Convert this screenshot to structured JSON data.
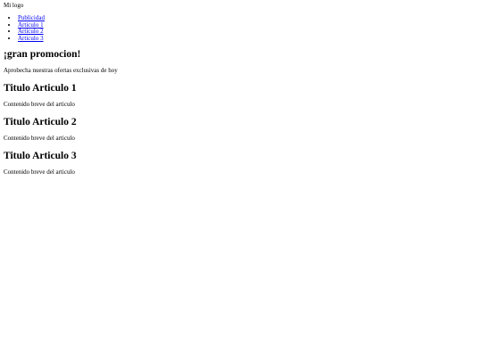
{
  "header": {
    "logo_text": "Mi logo"
  },
  "nav": {
    "items": [
      {
        "label": "Publicidad"
      },
      {
        "label": "Articulo 1"
      },
      {
        "label": "Articulo 2"
      },
      {
        "label": "Articulo 3"
      }
    ]
  },
  "promo": {
    "title": "¡gran promocion!",
    "text": "Aprobecha nuestras ofertas exclusivas de hoy"
  },
  "articles": [
    {
      "title": "Titulo Articulo 1",
      "summary": "Contenido breve del articulo"
    },
    {
      "title": "Titulo Articulo 2",
      "summary": "Contenido breve del articulo"
    },
    {
      "title": "Titulo Articulo 3",
      "summary": "Contenido breve del articulo"
    }
  ],
  "colors": {
    "link": "#0000ee",
    "text": "#000000",
    "background": "#ffffff"
  }
}
